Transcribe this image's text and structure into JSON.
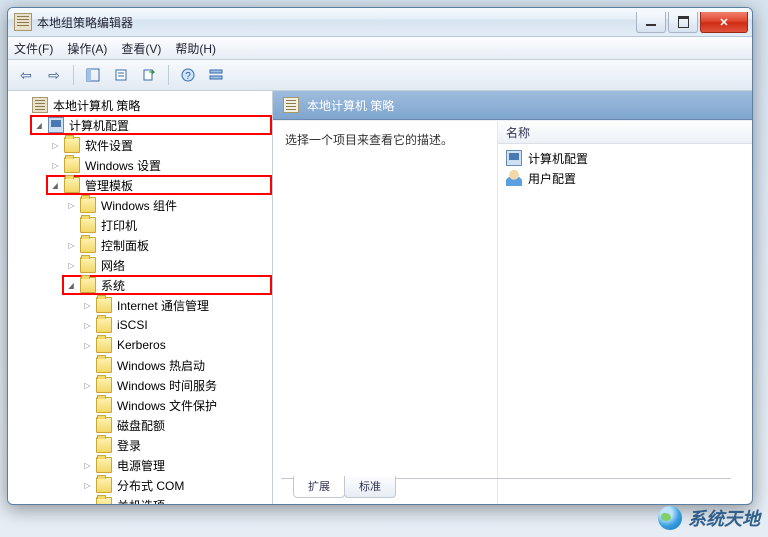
{
  "window": {
    "title": "本地组策略编辑器"
  },
  "menu": {
    "file": "文件(F)",
    "action": "操作(A)",
    "view": "查看(V)",
    "help": "帮助(H)"
  },
  "tree": {
    "root": "本地计算机 策略",
    "computer_cfg": "计算机配置",
    "software_settings": "软件设置",
    "windows_settings": "Windows 设置",
    "admin_templates": "管理模板",
    "windows_components": "Windows 组件",
    "printers": "打印机",
    "control_panel": "控制面板",
    "network": "网络",
    "system": "系统",
    "internet_comm": "Internet 通信管理",
    "iscsi": "iSCSI",
    "kerberos": "Kerberos",
    "windows_hot_start": "Windows 热启动",
    "windows_time_service": "Windows 时间服务",
    "windows_file_protection": "Windows 文件保护",
    "disk_quota": "磁盘配额",
    "logon": "登录",
    "power_management": "电源管理",
    "distributed_com": "分布式 COM",
    "shutdown_options": "关机选项"
  },
  "right": {
    "path_title": "本地计算机 策略",
    "description": "选择一个项目来查看它的描述。",
    "name_header": "名称",
    "items": {
      "computer": "计算机配置",
      "user": "用户配置"
    }
  },
  "tabs": {
    "extended": "扩展",
    "standard": "标准"
  },
  "watermark": "系统天地"
}
